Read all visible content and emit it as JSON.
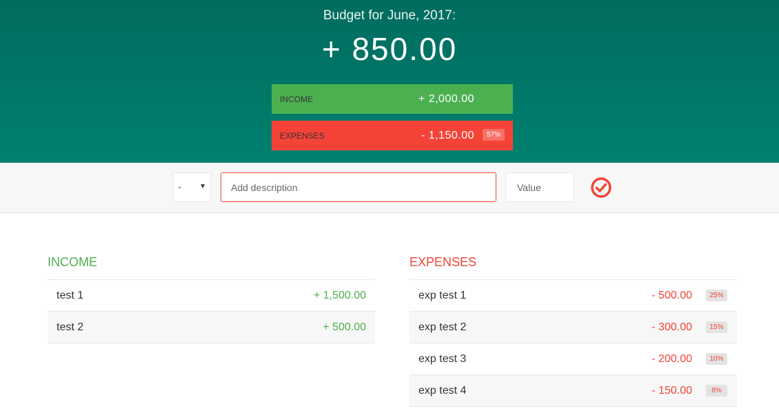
{
  "header": {
    "title": "Budget for June, 2017:",
    "total": "+ 850.00",
    "income": {
      "label": "Income",
      "amount": "+ 2,000.00"
    },
    "expenses": {
      "label": "Expenses",
      "amount": "- 1,150.00",
      "percentage": "57%"
    }
  },
  "add_bar": {
    "type_value": "-",
    "description_placeholder": "Add description",
    "value_placeholder": "Value",
    "submit_icon": "check-circle-icon"
  },
  "income": {
    "heading": "Income",
    "items": [
      {
        "description": "test 1",
        "amount": "+ 1,500.00"
      },
      {
        "description": "test 2",
        "amount": "+ 500.00"
      }
    ]
  },
  "expenses": {
    "heading": "Expenses",
    "items": [
      {
        "description": "exp test 1",
        "amount": "- 500.00",
        "percentage": "25%"
      },
      {
        "description": "exp test 2",
        "amount": "- 300.00",
        "percentage": "15%"
      },
      {
        "description": "exp test 3",
        "amount": "- 200.00",
        "percentage": "10%"
      },
      {
        "description": "exp test 4",
        "amount": "- 150.00",
        "percentage": "8%"
      }
    ]
  },
  "colors": {
    "header_start": "#006c5e",
    "header_end": "#00806f",
    "income": "#4caf50",
    "expenses": "#f44336"
  }
}
